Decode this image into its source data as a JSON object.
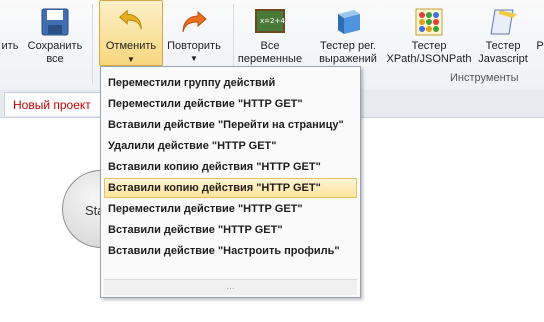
{
  "ribbon": {
    "partial_left_label": "ить",
    "save": {
      "line1": "Сохранить",
      "line2": "все"
    },
    "undo": {
      "label": "Отменить"
    },
    "redo": {
      "label": "Повторить"
    },
    "all_vars": {
      "line1": "Все",
      "line2": "переменные"
    },
    "regex_tester": {
      "line1": "Тестер рег.",
      "line2": "выражений"
    },
    "xpath_tester": {
      "line1": "Тестер",
      "line2": "XPath/JSONPath"
    },
    "js_tester": {
      "line1": "Тестер",
      "line2": "Javascript"
    },
    "partial_right_label": "Р",
    "group_tools_label": "Инструменты"
  },
  "tabs": {
    "active": "Новый проект"
  },
  "canvas": {
    "node_label": "Sta"
  },
  "undo_menu": {
    "items": [
      "Переместили группу действий",
      "Переместили действие \"HTTP GET\"",
      "Вставили действие \"Перейти на страницу\"",
      "Удалили действие \"HTTP GET\"",
      "Вставили копию действия \"HTTP GET\"",
      "Вставили копию действия \"HTTP GET\"",
      "Переместили действие \"HTTP GET\"",
      "Вставили действие \"HTTP GET\"",
      "Вставили действие \"Настроить профиль\""
    ],
    "highlighted_index": 5,
    "footer": "..."
  },
  "colors": {
    "accent_tab_text": "#c00000",
    "highlight": "#fde49a",
    "undo_arrow": "#e8b020",
    "redo_arrow": "#e87020"
  }
}
